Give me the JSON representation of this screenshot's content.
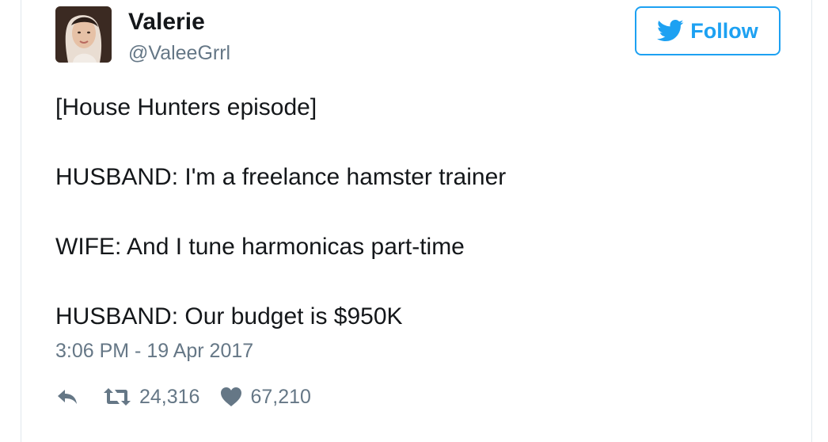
{
  "user": {
    "name": "Valerie",
    "handle": "@ValeeGrrl"
  },
  "follow_button": {
    "label": "Follow",
    "icon": "twitter-bird-icon"
  },
  "tweet": {
    "lines": [
      "[House Hunters episode]",
      "HUSBAND: I'm a freelance hamster trainer",
      "WIFE: And I tune harmonicas part-time",
      "HUSBAND: Our budget is $950K"
    ],
    "timestamp": "3:06 PM - 19 Apr 2017"
  },
  "actions": {
    "reply_icon": "reply-icon",
    "retweet_icon": "retweet-icon",
    "retweet_count": "24,316",
    "like_icon": "heart-icon",
    "like_count": "67,210"
  },
  "colors": {
    "accent": "#1da1f2",
    "text": "#14171a",
    "muted": "#657786",
    "border": "#e1e8ed"
  }
}
